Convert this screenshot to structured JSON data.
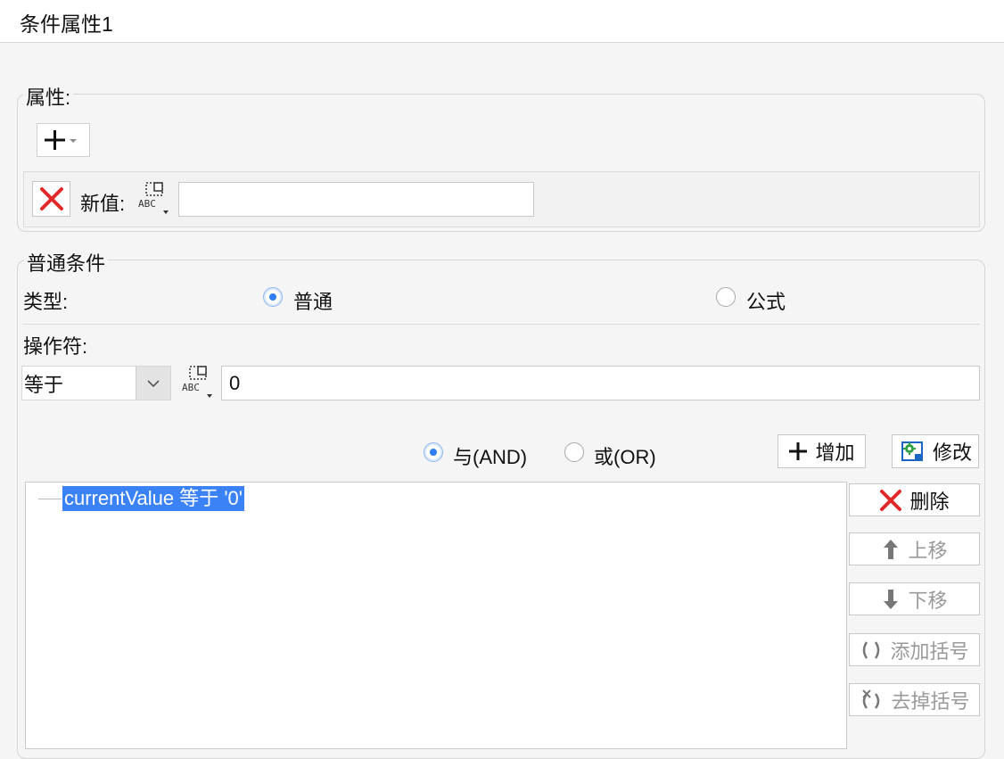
{
  "window": {
    "title": "条件属性1"
  },
  "attributes": {
    "legend": "属性:",
    "new_value_label": "新值:",
    "new_value": ""
  },
  "condition": {
    "legend": "普通条件",
    "type_label": "类型:",
    "type_options": [
      "普通",
      "公式"
    ],
    "type_selected": "普通",
    "operator_label": "操作符:",
    "operator_value": "等于",
    "operand_value": "0",
    "logic_options": [
      "与(AND)",
      "或(OR)"
    ],
    "logic_selected": "与(AND)",
    "add_label": "增加",
    "modify_label": "修改",
    "delete_label": "删除",
    "move_up_label": "上移",
    "move_down_label": "下移",
    "add_bracket_label": "添加括号",
    "remove_bracket_label": "去掉括号",
    "tree_items": [
      "currentValue 等于 '0'"
    ]
  },
  "icons": {
    "add": "plus-dropdown-icon",
    "remove_attr": "red-x-icon",
    "formula": "abc-formula-icon",
    "modify": "gear-edit-icon",
    "up": "arrow-up-icon",
    "down": "arrow-down-icon",
    "bracket": "bracket-icon",
    "remove_bracket": "remove-bracket-icon"
  },
  "colors": {
    "accent": "#3b82f6",
    "delete_red": "#e02a2a"
  }
}
